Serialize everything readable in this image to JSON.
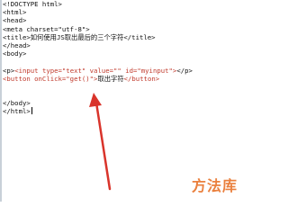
{
  "editor": {
    "lines": [
      {
        "segments": [
          {
            "text": "<!DOCTYPE html>",
            "color": "dark"
          }
        ]
      },
      {
        "segments": [
          {
            "text": "<html>",
            "color": "dark"
          }
        ]
      },
      {
        "segments": [
          {
            "text": "<head>",
            "color": "dark"
          }
        ]
      },
      {
        "segments": [
          {
            "text": "<meta charset=\"utf-8\">",
            "color": "dark"
          }
        ]
      },
      {
        "segments": [
          {
            "text": "<title>如何使用JS取出最后的三个字符</title>",
            "color": "dark"
          }
        ]
      },
      {
        "segments": [
          {
            "text": "</head>",
            "color": "dark"
          }
        ]
      },
      {
        "segments": [
          {
            "text": "<body>",
            "color": "dark"
          }
        ]
      },
      {
        "segments": []
      },
      {
        "segments": [
          {
            "text": "<p>",
            "color": "dark"
          },
          {
            "text": "<input type=\"text\" value=\"\" id=\"myinput\">",
            "color": "red"
          },
          {
            "text": "</p>",
            "color": "dark"
          }
        ]
      },
      {
        "segments": [
          {
            "text": "<button onClick=\"get()\">",
            "color": "red"
          },
          {
            "text": "取出字符",
            "color": "dark"
          },
          {
            "text": "</button>",
            "color": "red"
          }
        ]
      },
      {
        "segments": []
      },
      {
        "segments": []
      },
      {
        "segments": [
          {
            "text": "</body>",
            "color": "dark"
          }
        ]
      },
      {
        "segments": [
          {
            "text": "</html>",
            "color": "dark"
          }
        ],
        "caret": true
      }
    ]
  },
  "annotation": {
    "arrow_color": "#d9342b"
  },
  "watermark": {
    "text": "方法库",
    "color": "#e8732a"
  }
}
